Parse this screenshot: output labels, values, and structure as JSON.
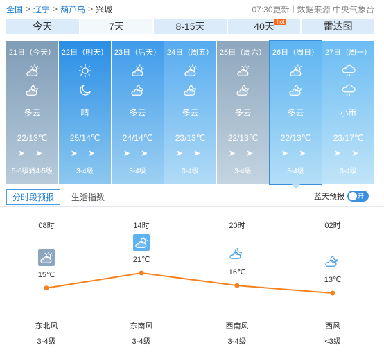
{
  "breadcrumb": {
    "country": "全国",
    "province": "辽宁",
    "city": "葫芦岛",
    "district": "兴城",
    "separator": ">"
  },
  "meta": {
    "update": "07:30更新",
    "divider": "|",
    "source": "数据来源 中央气象台"
  },
  "tabs": [
    {
      "label": "今天"
    },
    {
      "label": "7天"
    },
    {
      "label": "8-15天"
    },
    {
      "label": "40天",
      "badge": "hot"
    },
    {
      "label": "雷达图"
    }
  ],
  "days": [
    {
      "date": "21日（今天）",
      "icon_day": "partly-cloudy-icon",
      "icon_night": "partly-cloudy-night-icon",
      "cond": "多云",
      "temp": "22/13℃",
      "wind": "➤ ➤",
      "level": "5-6级转4-5级"
    },
    {
      "date": "22日（明天）",
      "icon_day": "sun-icon",
      "icon_night": "moon-icon",
      "cond": "晴",
      "temp": "25/14℃",
      "wind": "➤ ➤",
      "level": "3-4级"
    },
    {
      "date": "23日（后天）",
      "icon_day": "partly-cloudy-icon",
      "icon_night": "partly-cloudy-night-icon",
      "cond": "多云",
      "temp": "24/14℃",
      "wind": "➤ ➤",
      "level": "3-4级"
    },
    {
      "date": "24日（周五）",
      "icon_day": "partly-cloudy-icon",
      "icon_night": "partly-cloudy-night-icon",
      "cond": "多云",
      "temp": "23/13℃",
      "wind": "➤ ➤",
      "level": "3-4级"
    },
    {
      "date": "25日（周六）",
      "icon_day": "partly-cloudy-icon",
      "icon_night": "partly-cloudy-night-icon",
      "cond": "多云",
      "temp": "22/13℃",
      "wind": "➤ ➤",
      "level": "3-4级"
    },
    {
      "date": "26日（周日）",
      "icon_day": "partly-cloudy-icon",
      "icon_night": "partly-cloudy-night-icon",
      "cond": "多云",
      "temp": "22/13℃",
      "wind": "➤ ➤",
      "level": "3-4级"
    },
    {
      "date": "27日（周一）",
      "icon_day": "light-rain-icon",
      "icon_night": "light-rain-icon",
      "cond": "小雨",
      "temp": "23/17℃",
      "wind": "➤ ➤",
      "level": "3-4级"
    }
  ],
  "subtabs": {
    "hourly": "分时段预报",
    "life": "生活指数",
    "bluesky": "蓝天预报",
    "toggle": "开"
  },
  "hourly": [
    {
      "time": "08时",
      "temp": "15℃",
      "temp_value": 15,
      "icon": "partly-cloudy-icon",
      "dir": "东北风",
      "level": "3-4级"
    },
    {
      "time": "14时",
      "temp": "21℃",
      "temp_value": 21,
      "icon": "partly-cloudy-icon",
      "dir": "东南风",
      "level": "3-4级"
    },
    {
      "time": "20时",
      "temp": "16℃",
      "temp_value": 16,
      "icon": "partly-cloudy-night-icon",
      "dir": "西南风",
      "level": "3-4级"
    },
    {
      "time": "02时",
      "temp": "13℃",
      "temp_value": 13,
      "icon": "partly-cloudy-night-icon",
      "dir": "西风",
      "level": "<3级"
    }
  ],
  "colors": {
    "line": "#f58220",
    "accent": "#1e7dd1"
  }
}
